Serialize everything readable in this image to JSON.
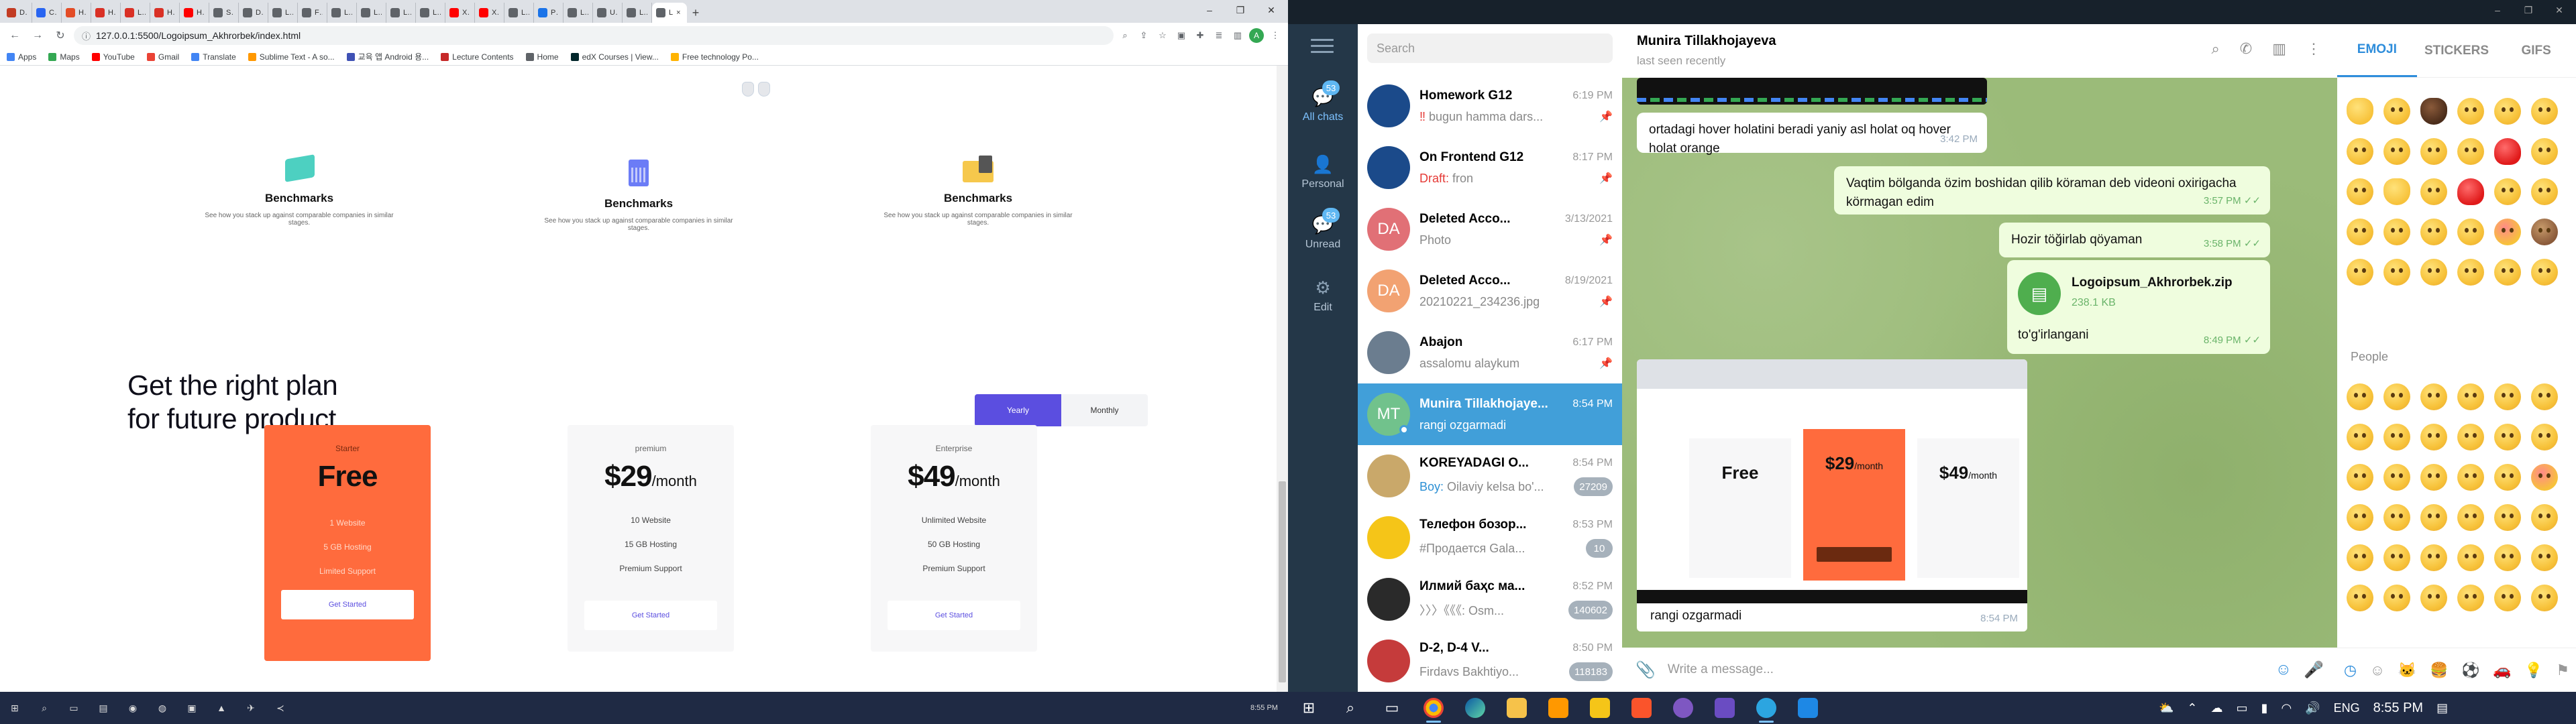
{
  "chrome": {
    "tabs": [
      {
        "label": "Dav",
        "color": "#c23b22"
      },
      {
        "label": "CSS",
        "color": "#2965f1"
      },
      {
        "label": "HTM",
        "color": "#e34c26"
      },
      {
        "label": "Hou",
        "color": "#d93025"
      },
      {
        "label": "Loyi",
        "color": "#d93025"
      },
      {
        "label": "Hom",
        "color": "#d93025"
      },
      {
        "label": "Hov",
        "color": "#ff0000"
      },
      {
        "label": "Start",
        "color": "#5f6368"
      },
      {
        "label": "Don",
        "color": "#5f6368"
      },
      {
        "label": "Last",
        "color": "#5f6368"
      },
      {
        "label": "Files",
        "color": "#5f6368"
      },
      {
        "label": "Logi",
        "color": "#5f6368"
      },
      {
        "label": "Logi",
        "color": "#5f6368"
      },
      {
        "label": "Logi",
        "color": "#5f6368"
      },
      {
        "label": "Logi",
        "color": "#5f6368"
      },
      {
        "label": "XOI",
        "color": "#ff0000"
      },
      {
        "label": "XOI",
        "color": "#ff0000"
      },
      {
        "label": "Lear",
        "color": "#5f6368"
      },
      {
        "label": "Post",
        "color": "#1a73e8"
      },
      {
        "label": "Logi",
        "color": "#5f6368"
      },
      {
        "label": "Untit",
        "color": "#5f6368"
      },
      {
        "label": "Logi",
        "color": "#5f6368"
      }
    ],
    "active_tab": "L",
    "url": "127.0.0.1:5500/Logoipsum_Akhrorbek/index.html",
    "bookmarks": [
      {
        "label": "Apps",
        "color": "#4285f4"
      },
      {
        "label": "Maps",
        "color": "#34a853"
      },
      {
        "label": "YouTube",
        "color": "#ff0000"
      },
      {
        "label": "Gmail",
        "color": "#ea4335"
      },
      {
        "label": "Translate",
        "color": "#4285f4"
      },
      {
        "label": "Sublime Text - A so...",
        "color": "#ff9800"
      },
      {
        "label": "교육 앱 Android 용...",
        "color": "#3f51b5"
      },
      {
        "label": "Lecture Contents",
        "color": "#c62828"
      },
      {
        "label": "Home",
        "color": "#5f6368"
      },
      {
        "label": "edX Courses | View...",
        "color": "#02262b"
      },
      {
        "label": "Free technology Po...",
        "color": "#ffb300"
      }
    ],
    "page": {
      "benchmarks": [
        {
          "title": "Benchmarks",
          "desc": "See how you stack up against comparable companies in similar stages.",
          "color": "#4dd0c1"
        },
        {
          "title": "Benchmarks",
          "desc": "See how you stack up against comparable companies in similar stages.",
          "color": "#6b7cf6"
        },
        {
          "title": "Benchmarks",
          "desc": "See how you stack up against comparable companies in similar stages.",
          "color": "#f6c84c"
        }
      ],
      "hero_line1": "Get the right plan",
      "hero_line2": "for future product.",
      "toggle_yearly": "Yearly",
      "toggle_monthly": "Monthly",
      "plans": [
        {
          "name": "Starter",
          "price": "Free",
          "per": "",
          "features": [
            "1 Website",
            "5 GB Hosting",
            "Limited Support"
          ],
          "cta": "Get Started"
        },
        {
          "name": "premium",
          "price": "$29",
          "per": "/month",
          "features": [
            "10 Website",
            "15 GB Hosting",
            "Premium Support"
          ],
          "cta": "Get Started"
        },
        {
          "name": "Enterprise",
          "price": "$49",
          "per": "/month",
          "features": [
            "Unlimited Website",
            "50 GB Hosting",
            "Premium Support"
          ],
          "cta": "Get Started"
        }
      ]
    }
  },
  "telegram": {
    "rail": {
      "all_chats": "All chats",
      "all_badge": "53",
      "personal": "Personal",
      "unread": "Unread",
      "unread_badge": "53",
      "edit": "Edit"
    },
    "search_placeholder": "Search",
    "chats": [
      {
        "name": "Homework G12",
        "time": "6:19 PM",
        "preview": "bugun hamma dars...",
        "prefix": "‼",
        "avatar": "#1b4a8a",
        "initials": "",
        "pinned": true,
        "counter": ""
      },
      {
        "name": "On Frontend G12",
        "time": "8:17 PM",
        "preview": "fron",
        "draft": "Draft:",
        "avatar": "#1b4a8a",
        "initials": "",
        "pinned": true,
        "counter": ""
      },
      {
        "name": "Deleted Acco...",
        "time": "3/13/2021",
        "preview": "Photo",
        "avatar": "#e17076",
        "initials": "DA",
        "pinned": true,
        "counter": ""
      },
      {
        "name": "Deleted Acco...",
        "time": "8/19/2021",
        "preview": "20210221_234236.jpg",
        "avatar": "#f2a272",
        "initials": "DA",
        "pinned": true,
        "counter": ""
      },
      {
        "name": "Abajon",
        "time": "6:17 PM",
        "preview": "assalomu alaykum",
        "avatar": "#6b7d8f",
        "initials": "",
        "pinned": true,
        "counter": ""
      },
      {
        "name": "Munira Tillakhojaye...",
        "time": "8:54 PM",
        "preview": "rangi ozgarmadi",
        "avatar": "#71c28c",
        "initials": "MT",
        "pinned": false,
        "counter": "",
        "active": true
      },
      {
        "name": "KOREYADAGI O...",
        "time": "8:54 PM",
        "preview": "Oilaviy kelsa bo'...",
        "sender": "Boy:",
        "avatar": "#c9a86a",
        "initials": "",
        "pinned": false,
        "counter": "27209"
      },
      {
        "name": "Телефон бозор...",
        "time": "8:53 PM",
        "preview": "#Продается Gala...",
        "avatar": "#f5c518",
        "initials": "",
        "pinned": false,
        "counter": "10"
      },
      {
        "name": "Илмий баҳс ма...",
        "time": "8:52 PM",
        "preview": "〉〉〉《《《: Osm...",
        "avatar": "#2a2a2a",
        "initials": "",
        "pinned": false,
        "counter": "140602"
      },
      {
        "name": "D-2, D-4 V...",
        "time": "8:50 PM",
        "preview": "Firdavs Bakhtiyo...",
        "avatar": "#c53b3b",
        "initials": "",
        "pinned": false,
        "counter": "118183"
      }
    ],
    "header": {
      "name": "Munira Tillakhojayeva",
      "status": "last seen recently"
    },
    "messages": [
      {
        "text": "ortadagi hover holatini beradi yaniy asl holat oq hover holat orange",
        "time": "3:42 PM",
        "out": false
      },
      {
        "text": "Vaqtim bölganda özim boshidan qilib köraman deb videoni oxirigacha körmagan edim",
        "time": "3:57 PM",
        "out": true
      },
      {
        "text": "Hozir töğirlab qöyaman",
        "time": "3:58 PM",
        "out": true
      },
      {
        "file_name": "Logoipsum_Akhrorbek.zip",
        "file_size": "238.1 KB",
        "caption": "to'g'irlangani",
        "time": "8:49 PM",
        "out": true
      },
      {
        "text": "rangi ozgarmadi",
        "time": "8:54 PM",
        "out": false
      }
    ],
    "input_placeholder": "Write a message...",
    "emoji_tabs": [
      "EMOJI",
      "STICKERS",
      "GIFS"
    ],
    "people_section": "People"
  },
  "taskbar": {
    "left_time": "8:55 PM",
    "right_time": "8:55 PM",
    "lang": "ENG"
  },
  "preview_shot": {
    "plans": [
      {
        "price": "Free",
        "per": ""
      },
      {
        "price": "$29",
        "per": "/month"
      },
      {
        "price": "$49",
        "per": "/month"
      }
    ]
  }
}
